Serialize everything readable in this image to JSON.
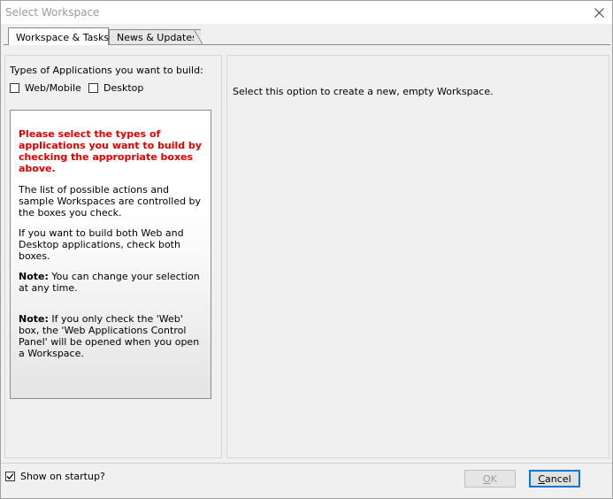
{
  "window": {
    "title": "Select Workspace"
  },
  "tabs": [
    {
      "label": "Workspace & Tasks",
      "active": true
    },
    {
      "label": "News & Updates",
      "active": false
    }
  ],
  "left": {
    "types_label": "Types of Applications you want to build:",
    "checkboxes": [
      {
        "label": "Web/Mobile",
        "checked": false
      },
      {
        "label": "Desktop",
        "checked": false
      }
    ],
    "info": {
      "warning": "Please select the types of applications you want to build by checking the appropriate boxes above.",
      "para1": "The list of possible actions and sample Workspaces are controlled by the boxes you check.",
      "para2": "If you want to build both Web and Desktop applications, check both boxes.",
      "note_prefix": "Note:",
      "note1": " You can change your selection at any time.",
      "note2": " If you only check the 'Web' box, the 'Web Applications Control Panel' will be opened when you open a Workspace."
    }
  },
  "right": {
    "description": "Select this option to create a new, empty Workspace."
  },
  "footer": {
    "startup_label": "Show on startup?",
    "startup_checked": true,
    "ok_first": "O",
    "ok_rest": "K",
    "cancel_first": "C",
    "cancel_rest": "ancel"
  },
  "colors": {
    "warning": "#e00000",
    "focus_border": "#0078d7"
  }
}
